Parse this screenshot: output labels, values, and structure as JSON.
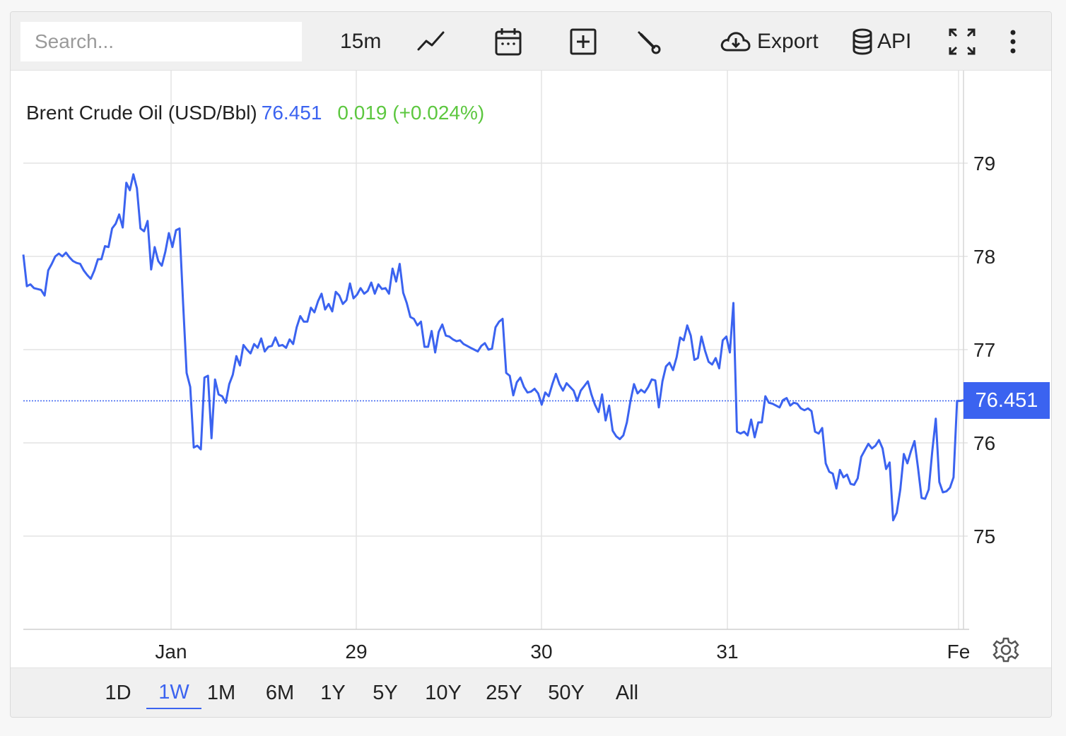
{
  "toolbar": {
    "search_placeholder": "Search...",
    "interval": "15m",
    "export_label": "Export",
    "api_label": "API"
  },
  "legend": {
    "symbol": "Brent Crude Oil (USD/Bbl)",
    "value": "76.451",
    "change": "0.019 (+0.024%)"
  },
  "price_tag": "76.451",
  "ranges": [
    "1D",
    "1W",
    "1M",
    "6M",
    "1Y",
    "5Y",
    "10Y",
    "25Y",
    "50Y",
    "All"
  ],
  "active_range": "1W",
  "colors": {
    "line": "#3b63f0",
    "positive": "#5cc73f"
  },
  "chart_data": {
    "type": "line",
    "x_tick_labels": [
      "Jan",
      "29",
      "30",
      "31",
      "Fe"
    ],
    "y_ticks": [
      75,
      76,
      77,
      78,
      79
    ],
    "ylim": [
      74,
      80
    ],
    "last_value": 76.451,
    "grid": true,
    "series": [
      {
        "values": [
          78.02,
          77.68,
          77.7,
          77.66,
          77.65,
          77.64,
          77.58,
          77.85,
          77.92,
          78.0,
          78.03,
          78.0,
          78.04,
          77.99,
          77.95,
          77.93,
          77.92,
          77.85,
          77.8,
          77.76,
          77.85,
          77.97,
          77.97,
          78.11,
          78.1,
          78.3,
          78.35,
          78.45,
          78.31,
          78.79,
          78.71,
          78.88,
          78.73,
          78.3,
          78.27,
          78.38,
          77.86,
          78.1,
          77.95,
          77.9,
          78.05,
          78.25,
          78.1,
          78.28,
          78.3,
          77.5,
          76.75,
          76.6,
          75.95,
          75.97,
          75.93,
          76.7,
          76.72,
          76.05,
          76.68,
          76.52,
          76.5,
          76.43,
          76.63,
          76.73,
          76.93,
          76.83,
          77.05,
          77.0,
          76.96,
          77.06,
          77.02,
          77.12,
          76.98,
          77.03,
          77.04,
          77.13,
          77.04,
          77.05,
          77.02,
          77.11,
          77.06,
          77.24,
          77.36,
          77.3,
          77.3,
          77.45,
          77.4,
          77.52,
          77.6,
          77.43,
          77.49,
          77.41,
          77.62,
          77.58,
          77.49,
          77.53,
          77.71,
          77.55,
          77.59,
          77.66,
          77.6,
          77.63,
          77.72,
          77.6,
          77.7,
          77.65,
          77.66,
          77.6,
          77.87,
          77.73,
          77.92,
          77.61,
          77.5,
          77.35,
          77.33,
          77.26,
          77.3,
          77.03,
          77.03,
          77.2,
          76.97,
          77.19,
          77.27,
          77.15,
          77.14,
          77.11,
          77.09,
          77.1,
          77.06,
          77.04,
          77.02,
          77.0,
          76.98,
          77.04,
          77.07,
          77.0,
          77.01,
          77.24,
          77.3,
          77.33,
          76.75,
          76.72,
          76.51,
          76.65,
          76.7,
          76.6,
          76.54,
          76.55,
          76.58,
          76.53,
          76.41,
          76.54,
          76.5,
          76.63,
          76.74,
          76.63,
          76.56,
          76.64,
          76.6,
          76.56,
          76.45,
          76.56,
          76.61,
          76.66,
          76.52,
          76.41,
          76.33,
          76.52,
          76.24,
          76.4,
          76.13,
          76.07,
          76.04,
          76.08,
          76.22,
          76.45,
          76.63,
          76.53,
          76.57,
          76.54,
          76.6,
          76.68,
          76.67,
          76.38,
          76.66,
          76.82,
          76.86,
          76.78,
          76.92,
          77.13,
          77.1,
          77.26,
          77.15,
          76.89,
          76.91,
          77.14,
          76.99,
          76.87,
          76.84,
          76.91,
          76.8,
          77.1,
          77.14,
          76.97,
          77.5,
          76.12,
          76.1,
          76.12,
          76.08,
          76.25,
          76.06,
          76.22,
          76.22,
          76.5,
          76.43,
          76.42,
          76.4,
          76.38,
          76.46,
          76.48,
          76.4,
          76.43,
          76.42,
          76.37,
          76.35,
          76.37,
          76.34,
          76.12,
          76.1,
          76.16,
          75.78,
          75.69,
          75.67,
          75.51,
          75.71,
          75.63,
          75.66,
          75.56,
          75.55,
          75.62,
          75.85,
          75.92,
          75.99,
          75.94,
          75.97,
          76.03,
          75.94,
          75.72,
          75.79,
          75.17,
          75.25,
          75.5,
          75.88,
          75.78,
          75.91,
          76.02,
          75.73,
          75.41,
          75.4,
          75.5,
          75.91,
          76.26,
          75.58,
          75.47,
          75.48,
          75.52,
          75.63,
          76.45,
          76.45,
          76.46,
          76.451
        ]
      }
    ]
  }
}
